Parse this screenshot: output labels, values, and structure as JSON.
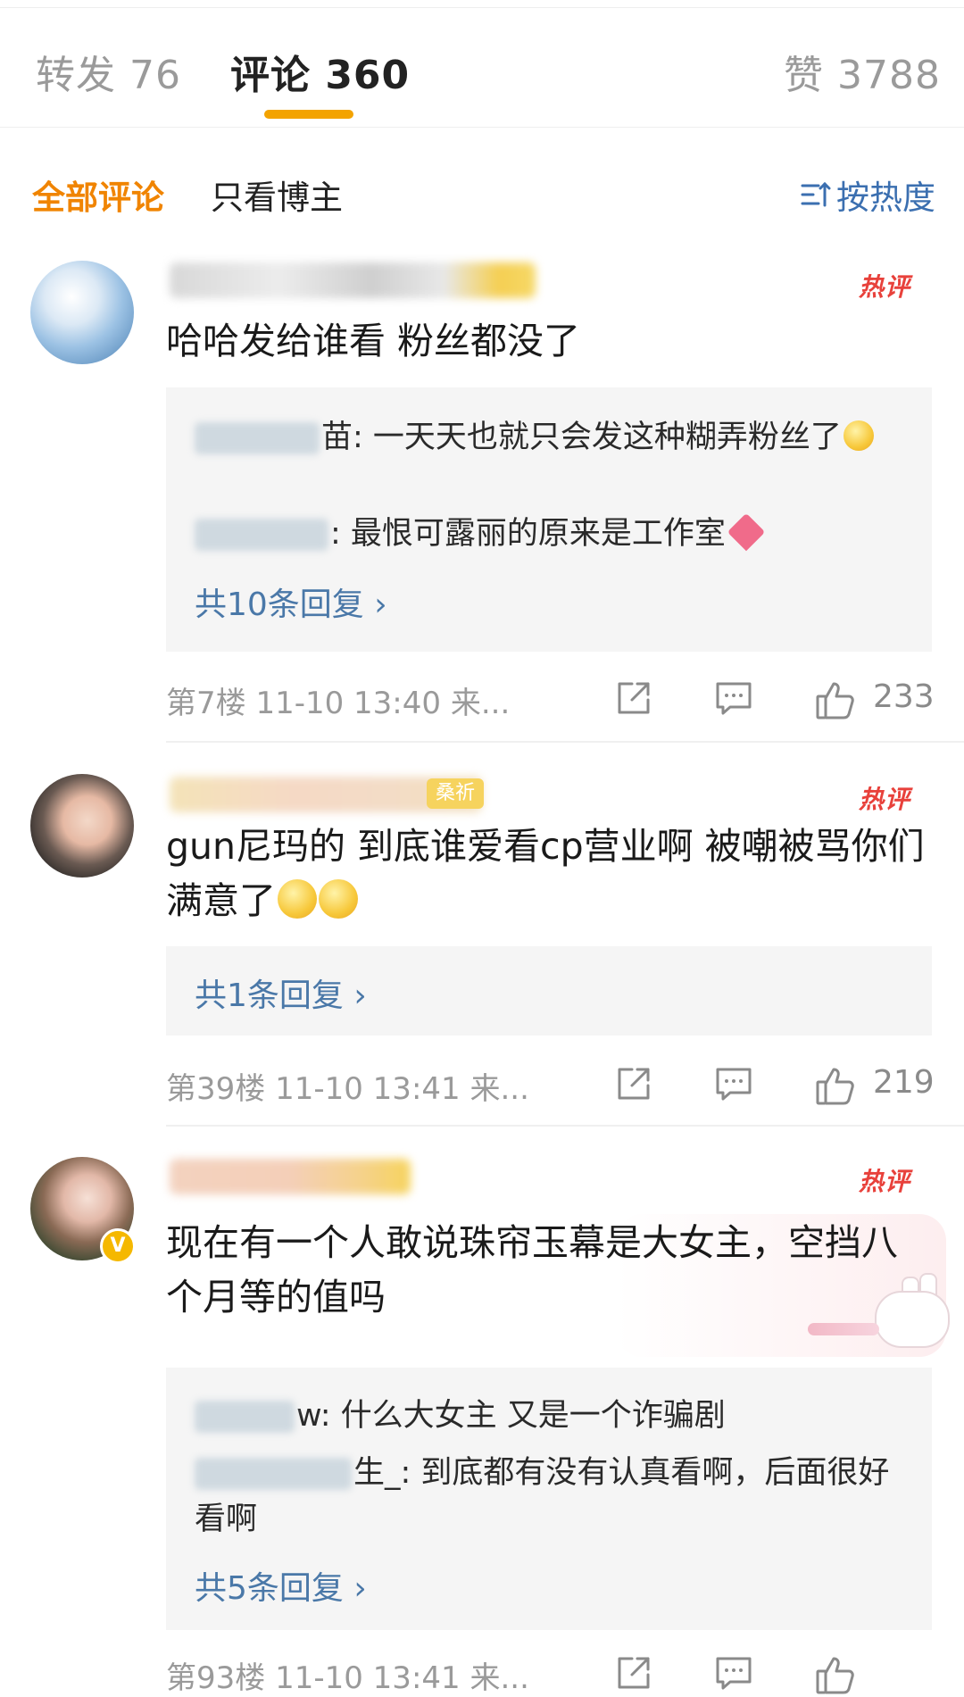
{
  "tabs": {
    "repost": "转发 76",
    "comments": "评论 360",
    "likes": "赞 3788"
  },
  "filters": {
    "all": "全部评论",
    "author_only": "只看博主",
    "sort": "按热度"
  },
  "comments": [
    {
      "hot_badge": "热评",
      "text": "哈哈发给谁看 粉丝都没了",
      "replies": [
        {
          "name_tail": "苗",
          "text": ": 一天天也就只会发这种糊弄粉丝了"
        },
        {
          "name_tail": "",
          "text": ": 最恨可露丽的原来是工作室"
        }
      ],
      "more": "共10条回复 ›",
      "meta": "第7楼 11-10 13:40 来...",
      "likes": "233"
    },
    {
      "hot_badge": "热评",
      "badge": "桑祈",
      "text": "gun尼玛的 到底谁爱看cp营业啊 被嘲被骂你们满意了",
      "more": "共1条回复 ›",
      "meta": "第39楼 11-10 13:41 来...",
      "likes": "219"
    },
    {
      "hot_badge": "热评",
      "verified": "V",
      "text": "现在有一个人敢说珠帘玉幕是大女主，空挡八个月等的值吗",
      "replies": [
        {
          "name_tail": "w",
          "text": ": 什么大女主 又是一个诈骗剧"
        },
        {
          "name_tail": "生_",
          "text": ": 到底都有没有认真看啊，后面很好看啊"
        }
      ],
      "more": "共5条回复 ›",
      "meta": "第93楼 11-10 13:41 来..."
    }
  ],
  "icons": [
    "share-icon",
    "comment-icon",
    "like-icon",
    "sort-icon",
    "chevron-right-icon"
  ],
  "colors": {
    "accent_orange": "#f08400",
    "tab_underline": "#f3a300",
    "link_blue": "#4a78a8",
    "hot_red": "#e8413b"
  }
}
